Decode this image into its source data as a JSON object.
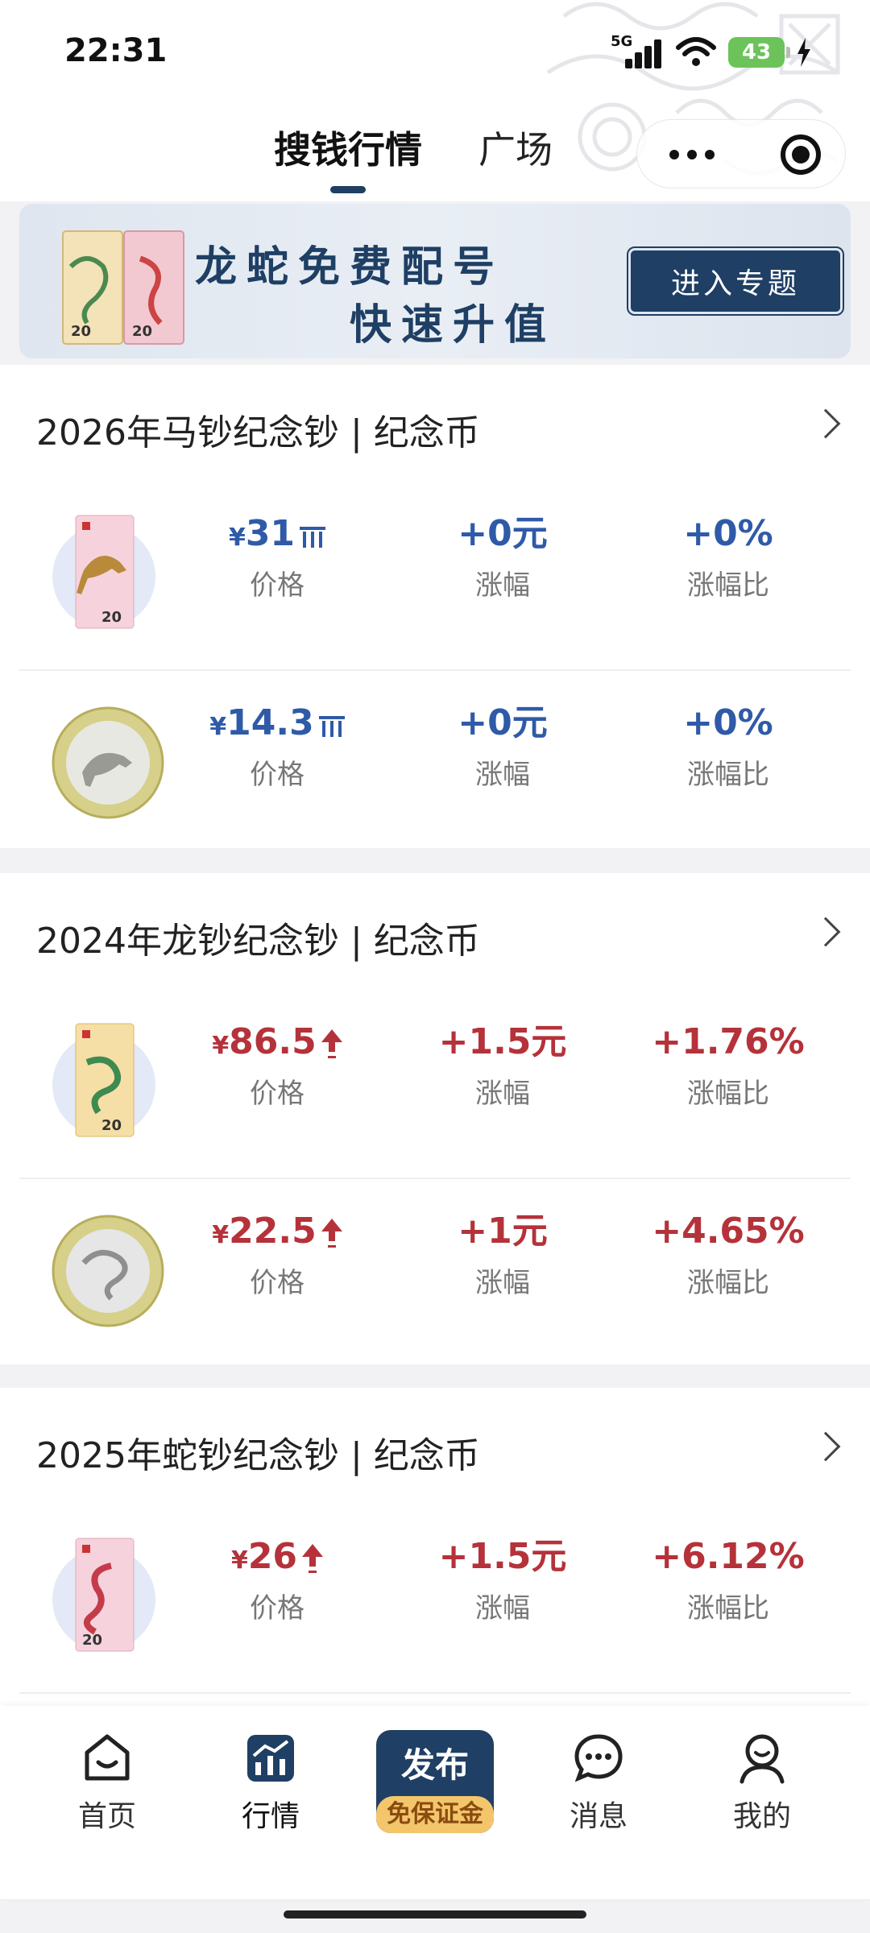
{
  "status_bar": {
    "time": "22:31",
    "network": "5G",
    "battery": "43"
  },
  "header": {
    "tabs": [
      {
        "label": "搜钱行情",
        "active": true
      },
      {
        "label": "广场",
        "active": false
      }
    ]
  },
  "banner": {
    "line1": "龙蛇免费配号",
    "line2": "快速升值",
    "button": "进入专题"
  },
  "sections": [
    {
      "title": "2026年马钞纪念钞 | 纪念币",
      "rows": [
        {
          "thumb": "horse-banknote",
          "price": "31",
          "change": "+0元",
          "ratio": "+0%",
          "trend": "flat",
          "color": "#2f5aa8"
        },
        {
          "thumb": "horse-coin",
          "price": "14.3",
          "change": "+0元",
          "ratio": "+0%",
          "trend": "flat",
          "color": "#2f5aa8"
        }
      ]
    },
    {
      "title": "2024年龙钞纪念钞 | 纪念币",
      "rows": [
        {
          "thumb": "dragon-banknote",
          "price": "86.5",
          "change": "+1.5元",
          "ratio": "+1.76%",
          "trend": "up",
          "color": "#b5323a"
        },
        {
          "thumb": "dragon-coin",
          "price": "22.5",
          "change": "+1元",
          "ratio": "+4.65%",
          "trend": "up",
          "color": "#b5323a"
        }
      ]
    },
    {
      "title": "2025年蛇钞纪念钞 | 纪念币",
      "rows": [
        {
          "thumb": "snake-banknote",
          "price": "26",
          "change": "+1.5元",
          "ratio": "+6.12%",
          "trend": "up",
          "color": "#b5323a"
        }
      ]
    }
  ],
  "labels": {
    "price": "价格",
    "change": "涨幅",
    "ratio": "涨幅比",
    "currency": "¥"
  },
  "bottom_nav": {
    "items": [
      {
        "label": "首页",
        "icon": "home-icon",
        "active": false
      },
      {
        "label": "行情",
        "icon": "market-chart-icon",
        "active": true
      },
      {
        "label": "消息",
        "icon": "message-icon",
        "active": false
      },
      {
        "label": "我的",
        "icon": "profile-icon",
        "active": false
      }
    ],
    "publish": {
      "title": "发布",
      "subtitle": "免保证金"
    }
  },
  "colors": {
    "accent_navy": "#1f3f64",
    "up_red": "#b5323a",
    "flat_blue": "#2f5aa8",
    "publish_gold": "#f3c66b"
  }
}
